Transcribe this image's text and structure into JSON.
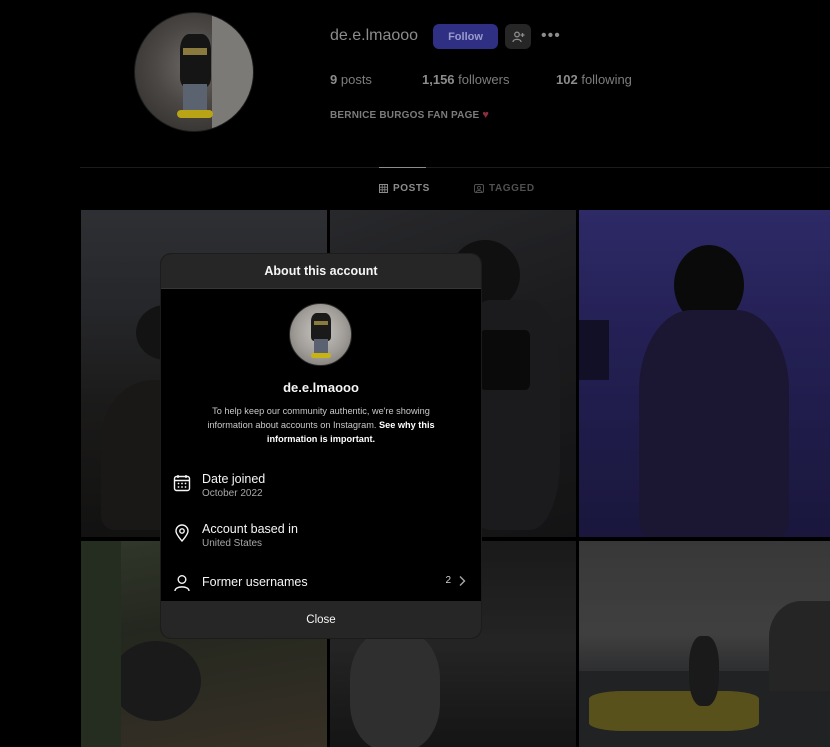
{
  "profile": {
    "username": "de.e.lmaooo",
    "follow_label": "Follow",
    "posts_count": "9",
    "posts_label": "posts",
    "followers_count": "1,156",
    "followers_label": "followers",
    "following_count": "102",
    "following_label": "following",
    "bio": "BERNICE BURGOS FAN PAGE",
    "bio_emoji": "♥"
  },
  "tabs": [
    {
      "label": "POSTS",
      "icon": "grid-icon",
      "active": true
    },
    {
      "label": "TAGGED",
      "icon": "tag-icon",
      "active": false
    }
  ],
  "modal": {
    "title": "About this account",
    "username": "de.e.lmaooo",
    "description": "To help keep our community authentic, we're showing information about accounts on Instagram.",
    "description_link": "See why this information is important.",
    "date_joined_label": "Date joined",
    "date_joined_value": "October 2022",
    "based_in_label": "Account based in",
    "based_in_value": "United States",
    "former_usernames_label": "Former usernames",
    "former_usernames_count": "2",
    "close_label": "Close"
  },
  "colors": {
    "background": "#000000",
    "follow_button": "#2f2f83",
    "modal_header": "#262626",
    "heart": "#8c2d3d"
  }
}
